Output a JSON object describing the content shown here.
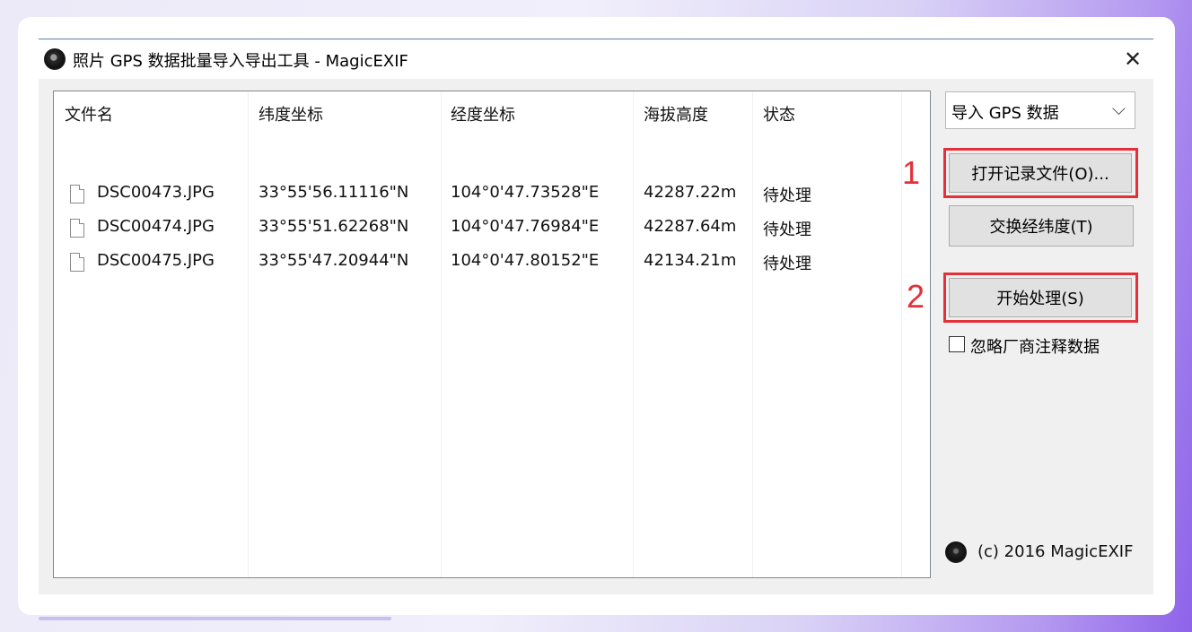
{
  "window": {
    "title": "照片 GPS 数据批量导入导出工具 - MagicEXIF",
    "close_glyph": "✕"
  },
  "table": {
    "headers": [
      "文件名",
      "纬度坐标",
      "经度坐标",
      "海拔高度",
      "状态"
    ],
    "rows": [
      {
        "file": "DSC00473.JPG",
        "lat": "33°55'56.11116\"N",
        "lon": "104°0'47.73528\"E",
        "alt": "42287.22m",
        "status": "待处理"
      },
      {
        "file": "DSC00474.JPG",
        "lat": "33°55'51.62268\"N",
        "lon": "104°0'47.76984\"E",
        "alt": "42287.64m",
        "status": "待处理"
      },
      {
        "file": "DSC00475.JPG",
        "lat": "33°55'47.20944\"N",
        "lon": "104°0'47.80152\"E",
        "alt": "42134.21m",
        "status": "待处理"
      }
    ]
  },
  "mode_select": {
    "value": "导入 GPS 数据",
    "arrow": "⌵"
  },
  "buttons": {
    "open_record": "打开记录文件(O)...",
    "swap_latlon": "交换经纬度(T)",
    "start": "开始处理(S)"
  },
  "annotations": {
    "step1": "1",
    "step2": "2",
    "accent_color": "#e5303a"
  },
  "checkbox": {
    "label": "忽略厂商注释数据",
    "checked": false
  },
  "footer": {
    "copyright": "(c) 2016 MagicEXIF"
  }
}
